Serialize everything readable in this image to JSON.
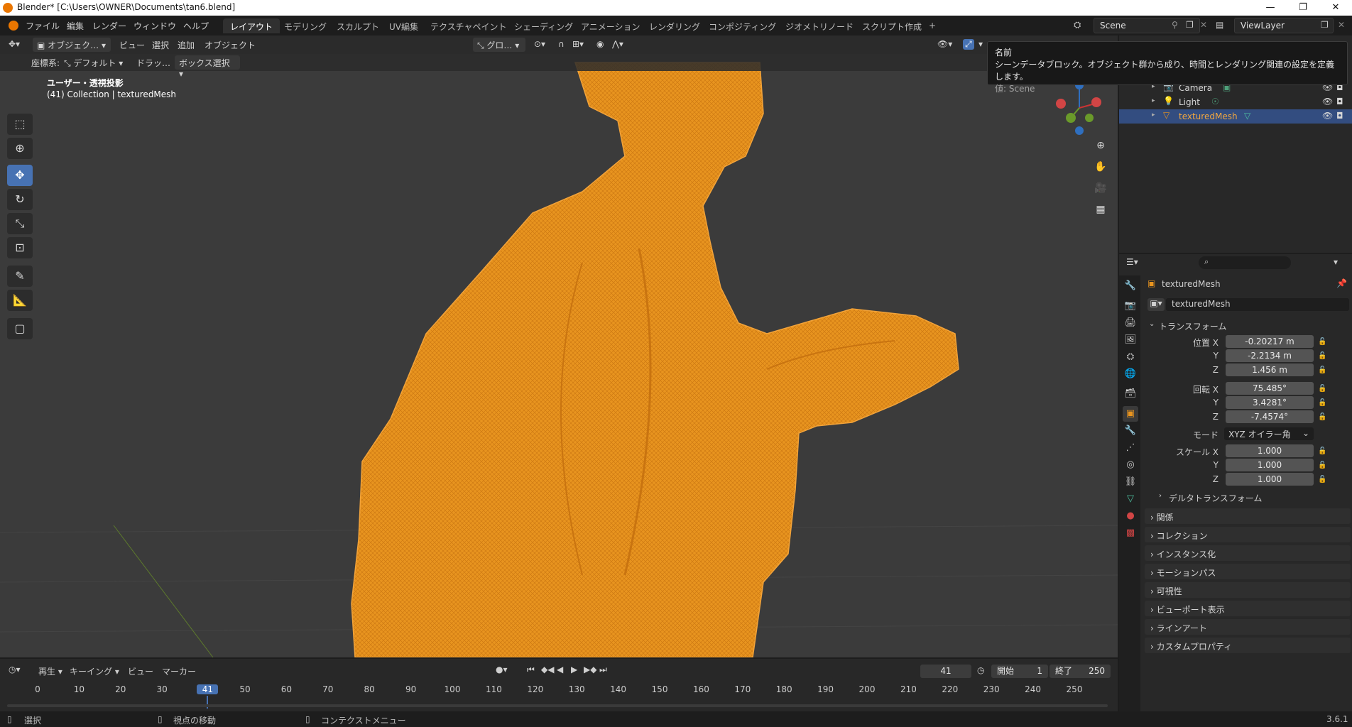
{
  "window": {
    "title": "Blender* [C:\\Users\\OWNER\\Documents\\tan6.blend]",
    "minimize": "—",
    "maximize": "❐",
    "close": "✕"
  },
  "menu": [
    "ファイル",
    "編集",
    "レンダー",
    "ウィンドウ",
    "ヘルプ"
  ],
  "workspaces": [
    "レイアウト",
    "モデリング",
    "スカルプト",
    "UV編集",
    "テクスチャペイント",
    "シェーディング",
    "アニメーション",
    "レンダリング",
    "コンポジティング",
    "ジオメトリノード",
    "スクリプト作成"
  ],
  "workspace_add": "+",
  "scene": {
    "name": "Scene",
    "view_layer": "ViewLayer"
  },
  "viewport": {
    "mode": "オブジェク…",
    "menus": [
      "ビュー",
      "選択",
      "追加",
      "オブジェクト"
    ],
    "orientation": "グロ…",
    "coord_label": "座標系:",
    "coord_value": "デフォルト",
    "drag_label": "ドラッ…",
    "select_mode": "ボックス選択",
    "view_name": "ユーザー・透視投影",
    "collection_info": "(41) Collection | texturedMesh"
  },
  "tooltip": {
    "title": "名前",
    "description": "シーンデータブロック。オブジェクト群から成り、時間とレンダリング関連の設定を定義します。",
    "value": "値: Scene"
  },
  "outliner": {
    "items": [
      {
        "label": "Camera",
        "icon": "camera-icon"
      },
      {
        "label": "Light",
        "icon": "light-icon"
      },
      {
        "label": "texturedMesh",
        "icon": "mesh-icon"
      }
    ]
  },
  "properties": {
    "object_name": "texturedMesh",
    "datablock": "texturedMesh",
    "transform_title": "トランスフォーム",
    "location": {
      "label": "位置 X",
      "x": "-0.20217 m",
      "y": "-2.2134 m",
      "z": "1.456 m"
    },
    "rotation": {
      "label": "回転 X",
      "x": "75.485°",
      "y": "3.4281°",
      "z": "-7.4574°"
    },
    "mode_label": "モード",
    "mode_value": "XYZ オイラー角",
    "scale": {
      "label": "スケール X",
      "x": "1.000",
      "y": "1.000",
      "z": "1.000"
    },
    "axis_y": "Y",
    "axis_z": "Z",
    "delta_transform": "デルタトランスフォーム",
    "panels": [
      "関係",
      "コレクション",
      "インスタンス化",
      "モーションパス",
      "可視性",
      "ビューポート表示",
      "ラインアート",
      "カスタムプロパティ"
    ]
  },
  "timeline": {
    "menus": [
      "再生",
      "キーイング",
      "ビュー",
      "マーカー"
    ],
    "current_frame": "41",
    "start_label": "開始",
    "start": "1",
    "end_label": "終了",
    "end": "250",
    "ticks": [
      "0",
      "10",
      "20",
      "30",
      "41",
      "50",
      "60",
      "70",
      "80",
      "90",
      "100",
      "110",
      "120",
      "130",
      "140",
      "150",
      "160",
      "170",
      "180",
      "190",
      "200",
      "210",
      "220",
      "230",
      "240",
      "250"
    ]
  },
  "statusbar": {
    "select": "選択",
    "move_view": "視点の移動",
    "context_menu": "コンテクストメニュー",
    "version": "3.6.1"
  },
  "colors": {
    "accent": "#4772b3",
    "mesh": "#e8941f",
    "selected_row": "#334d80",
    "frame_marker": "#4772b3"
  }
}
